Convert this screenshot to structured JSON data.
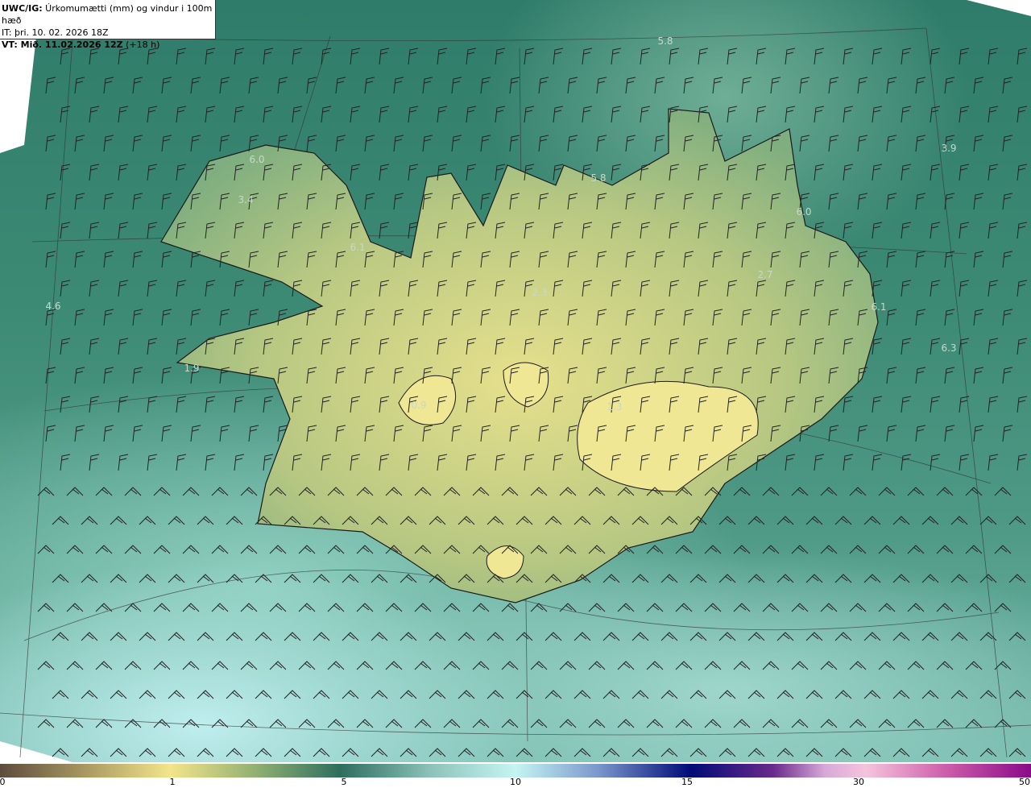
{
  "header": {
    "title_bold": "UWC/IG:",
    "title_rest": " Úrkomumætti (mm) og vindur i 100m hæð",
    "init_time": "IT: þri. 10. 02. 2026 18Z",
    "valid_bold": "VT: Mið. 11.02.2026 12Z",
    "valid_rest": " (+18 h)"
  },
  "map_values": [
    "5.8",
    "6.0",
    "3.4",
    "5.8",
    "3.9",
    "6.0",
    "6.1",
    "2.7",
    "2.3",
    "4.6",
    "6.1",
    "6.3",
    "1.9",
    "0.9",
    "1.3"
  ],
  "colorbar": {
    "ticks": [
      "0",
      "1",
      "5",
      "10",
      "15",
      "30",
      "50"
    ]
  },
  "colors": {
    "land_low": "#e8e08a",
    "sea": "#3d8a74"
  }
}
